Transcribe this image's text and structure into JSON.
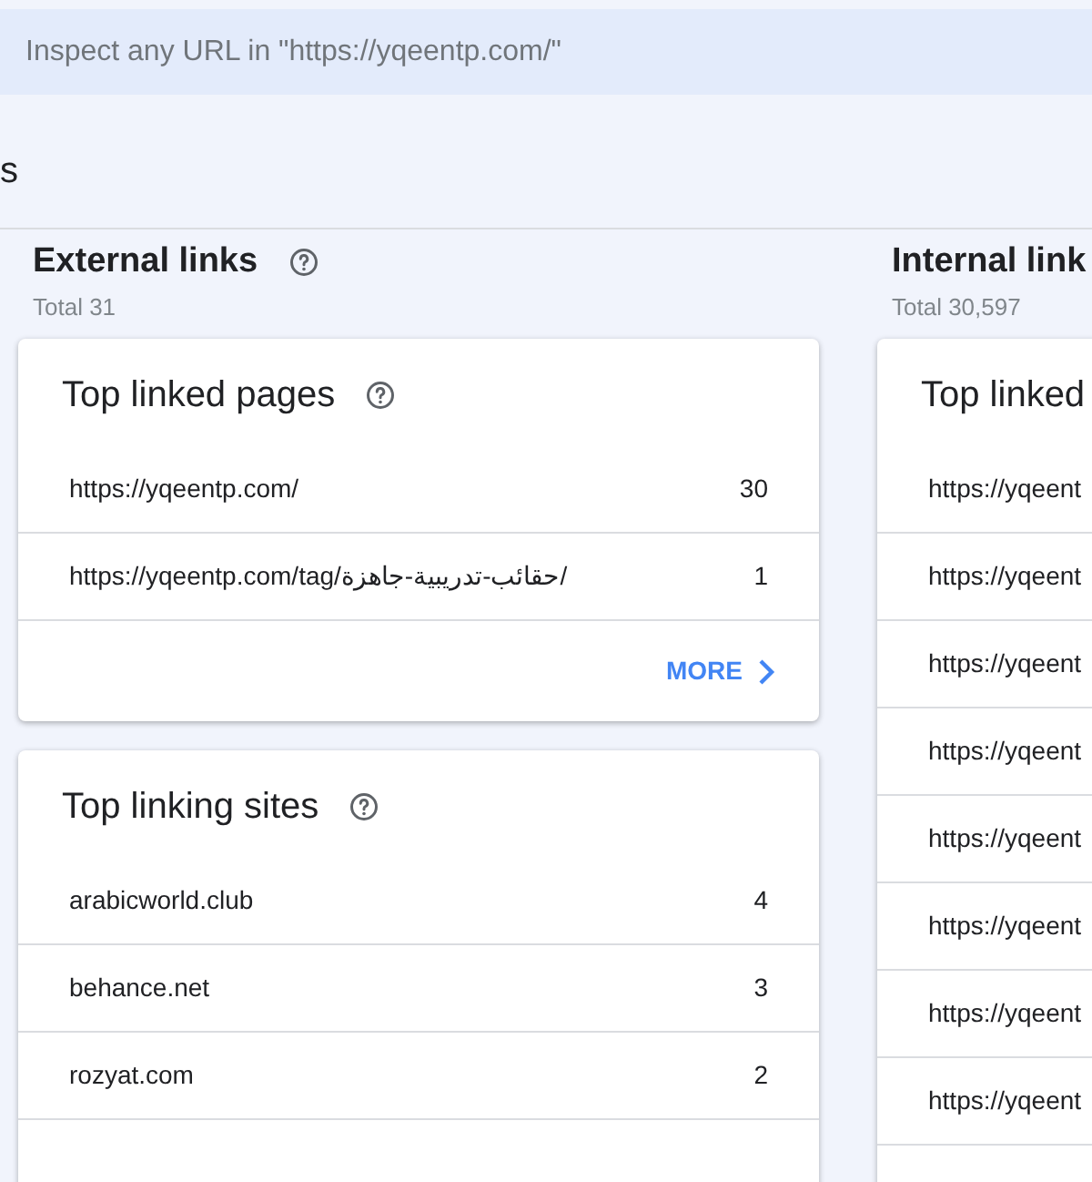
{
  "search": {
    "placeholder": "Inspect any URL in \"https://yqeentp.com/\""
  },
  "page_title": "s",
  "columns": [
    {
      "title": "External links",
      "total": "Total 31",
      "help": true,
      "cards": [
        {
          "title": "Top linked pages",
          "help": true,
          "rows": [
            {
              "label": "https://yqeentp.com/",
              "count": "30"
            },
            {
              "label": "https://yqeentp.com/tag/حقائب-تدريبية-جاهزة/",
              "count": "1"
            }
          ],
          "more": "MORE"
        },
        {
          "title": "Top linking sites",
          "help": true,
          "rows": [
            {
              "label": "arabicworld.club",
              "count": "4"
            },
            {
              "label": "behance.net",
              "count": "3"
            },
            {
              "label": "rozyat.com",
              "count": "2"
            }
          ]
        }
      ]
    },
    {
      "title": "Internal link",
      "total": "Total 30,597",
      "cards": [
        {
          "title": "Top linked",
          "rows": [
            {
              "label": "https://yqeent"
            },
            {
              "label": "https://yqeent"
            },
            {
              "label": "https://yqeent"
            },
            {
              "label": "https://yqeent"
            },
            {
              "label": "https://yqeent"
            },
            {
              "label": "https://yqeent"
            },
            {
              "label": "https://yqeent"
            },
            {
              "label": "https://yqeent"
            }
          ]
        }
      ]
    }
  ]
}
